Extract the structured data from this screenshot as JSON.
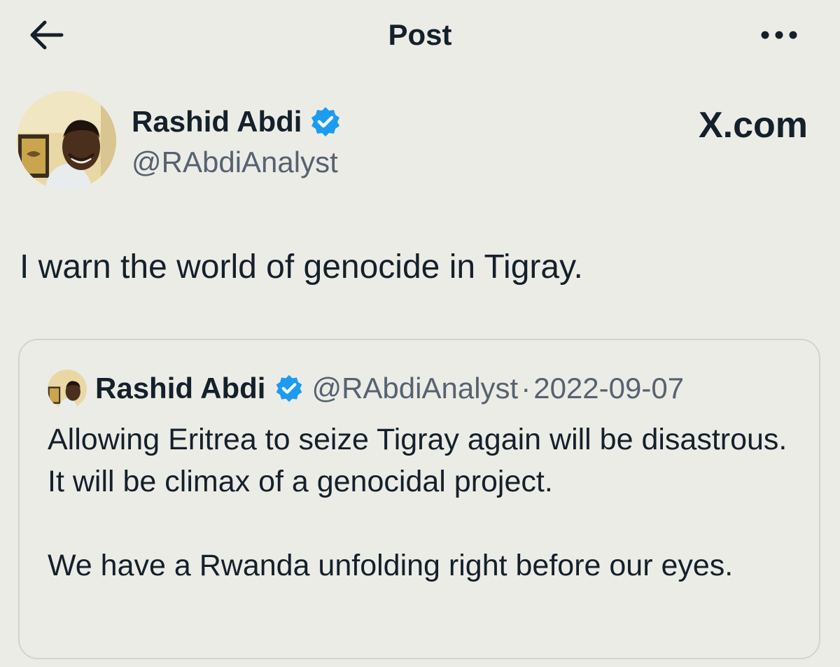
{
  "header": {
    "title": "Post",
    "back_icon": "arrow-left-icon",
    "more_icon": "more-horizontal-icon"
  },
  "post": {
    "author": {
      "name": "Rashid Abdi",
      "handle": "@RAbdiAnalyst",
      "verified_icon": "verified-badge-icon"
    },
    "brand": "X.com",
    "text": "I warn the world of genocide in Tigray."
  },
  "quoted_post": {
    "author": {
      "name": "Rashid Abdi",
      "handle": "@RAbdiAnalyst"
    },
    "separator": "·",
    "date": "2022-09-07",
    "paragraphs": [
      "Allowing Eritrea to seize Tigray again will be disastrous. It will be climax of a genocidal project.",
      "We have a Rwanda unfolding right before our eyes."
    ]
  },
  "colors": {
    "background": "#ecece6",
    "text": "#14202b",
    "muted": "#566270",
    "verified": "#1d9bf0",
    "card_border": "#cfd4d3"
  }
}
